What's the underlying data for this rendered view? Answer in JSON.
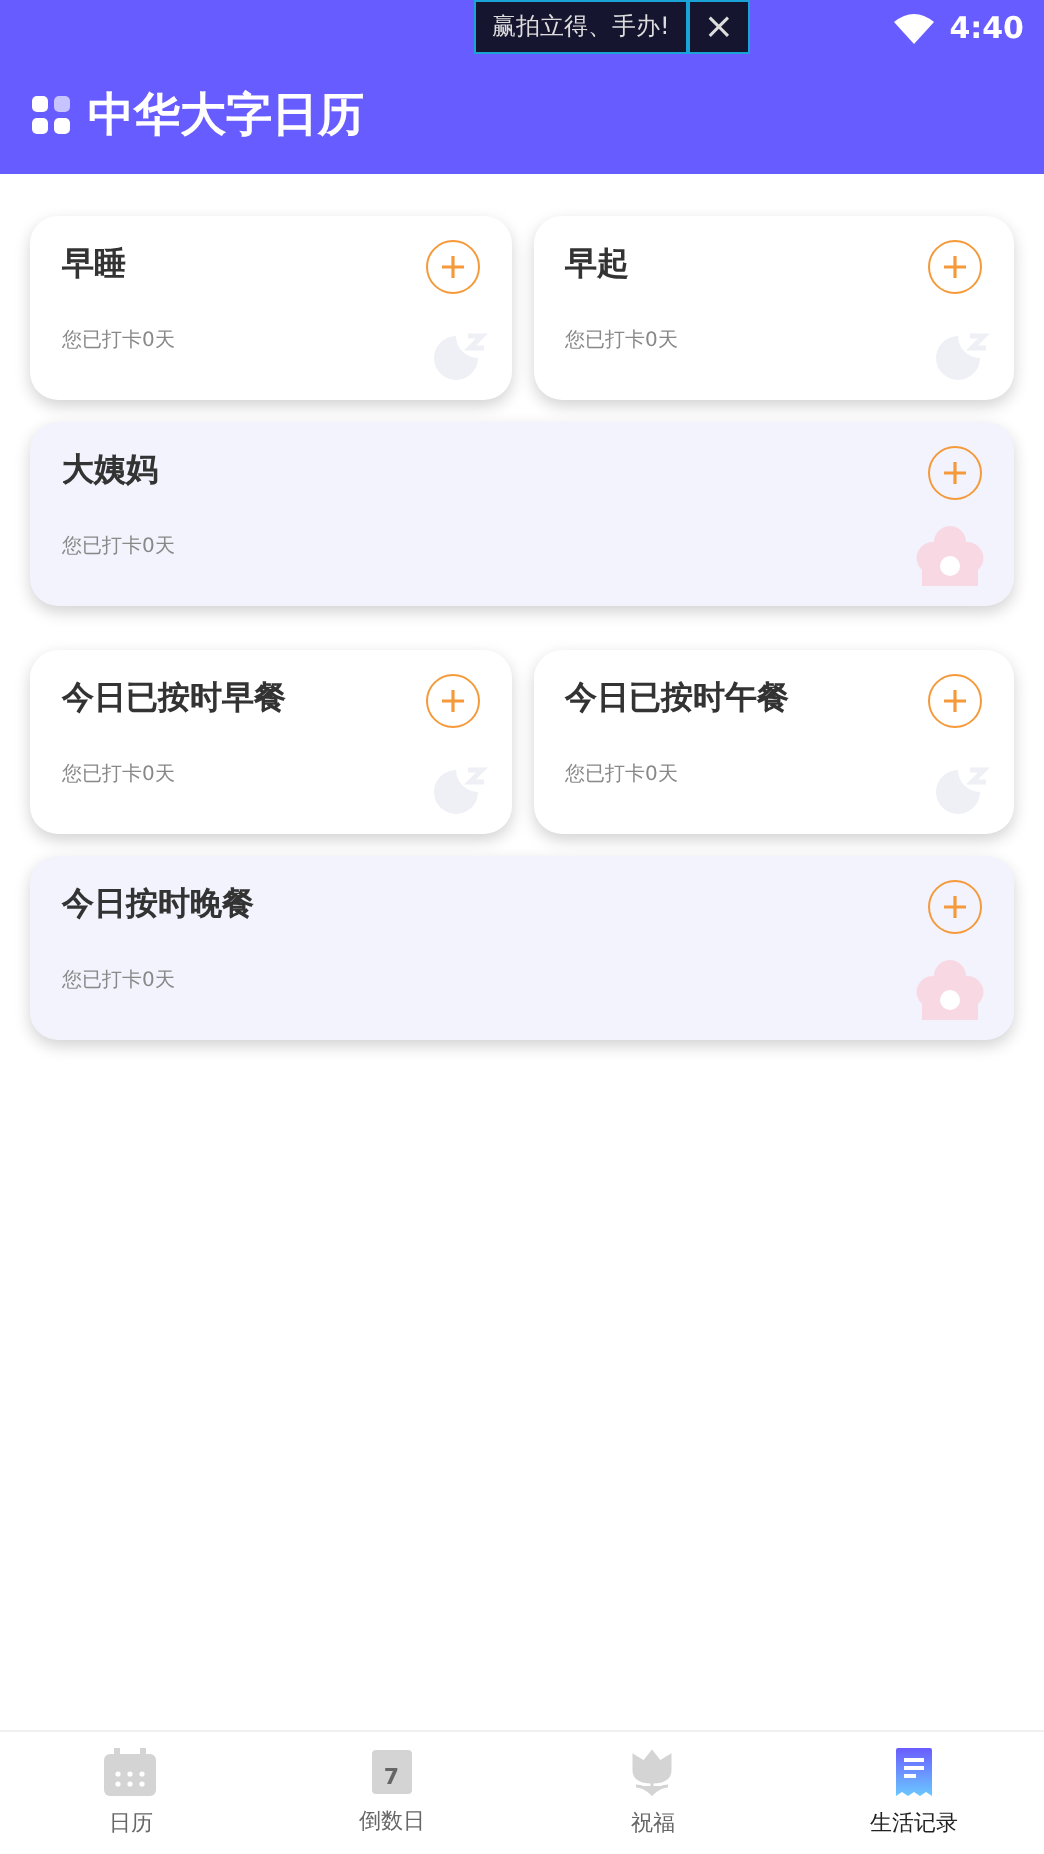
{
  "status_bar": {
    "ad_text": "赢拍立得、手办!",
    "close_glyph": "×",
    "time": "4:40"
  },
  "header": {
    "title": "中华大字日历"
  },
  "groups": [
    {
      "cards": [
        {
          "title": "早睡",
          "subtitle": "您已打卡0天",
          "kind": "sleep"
        },
        {
          "title": "早起",
          "subtitle": "您已打卡0天",
          "kind": "sleep"
        },
        {
          "title": "大姨妈",
          "subtitle": "您已打卡0天",
          "kind": "flower"
        }
      ]
    },
    {
      "cards": [
        {
          "title": "今日已按时早餐",
          "subtitle": "您已打卡0天",
          "kind": "sleep"
        },
        {
          "title": "今日已按时午餐",
          "subtitle": "您已打卡0天",
          "kind": "sleep"
        },
        {
          "title": "今日按时晚餐",
          "subtitle": "您已打卡0天",
          "kind": "flower"
        }
      ]
    }
  ],
  "tabs": [
    {
      "label": "日历",
      "selected": false
    },
    {
      "label": "倒数日",
      "icon_text": "7",
      "selected": false
    },
    {
      "label": "祝福",
      "selected": false
    },
    {
      "label": "生活记录",
      "selected": true
    }
  ]
}
